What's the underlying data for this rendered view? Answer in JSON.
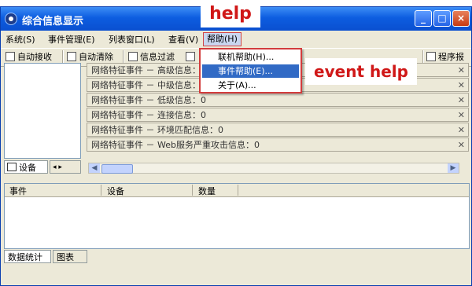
{
  "window": {
    "title": "综合信息显示",
    "controls": {
      "minimize": "_",
      "maximize": "□",
      "close": "×"
    }
  },
  "menubar": [
    "系统(S)",
    "事件管理(E)",
    "列表窗口(L)",
    "查看(V)",
    "帮助(H)"
  ],
  "toolbar": {
    "items": [
      "自动接收",
      "自动清除",
      "信息过滤",
      "程序报警"
    ]
  },
  "help_menu": {
    "items": [
      "联机帮助(H)...",
      "事件帮助(E)...",
      "关于(A)..."
    ],
    "selected_index": 1
  },
  "left_panel": {
    "tab_label": "设备"
  },
  "event_list": [
    "网络特征事件 － 高级信息：0",
    "网络特征事件 － 中级信息：0",
    "网络特征事件 － 低级信息：0",
    "网络特征事件 － 连接信息：0",
    "网络特征事件 － 环境匹配信息：0",
    "网络特征事件 － Web服务严重攻击信息：0"
  ],
  "stats_table": {
    "columns": [
      "事件",
      "设备",
      "数量"
    ]
  },
  "bottom_tabs": [
    "数据统计",
    "图表"
  ],
  "annotations": {
    "help": "help",
    "event_help": "event help"
  },
  "colors": {
    "titlebar": "#0d5de0",
    "annotation": "#d01818",
    "selection": "#316ac5"
  }
}
